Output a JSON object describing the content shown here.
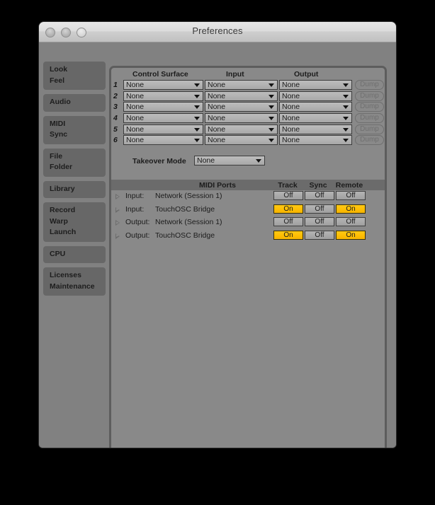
{
  "window": {
    "title": "Preferences",
    "traffic_lights": [
      "close-button",
      "minimize-button",
      "zoom-button"
    ]
  },
  "sidebar": {
    "groups": [
      {
        "lines": [
          "Look",
          "Feel"
        ]
      },
      {
        "lines": [
          "Audio"
        ]
      },
      {
        "lines": [
          "MIDI",
          "Sync"
        ]
      },
      {
        "lines": [
          "File",
          "Folder"
        ]
      },
      {
        "lines": [
          "Library"
        ]
      },
      {
        "lines": [
          "Record",
          "Warp",
          "Launch"
        ]
      },
      {
        "lines": [
          "CPU"
        ]
      },
      {
        "lines": [
          "Licenses",
          "Maintenance"
        ]
      }
    ]
  },
  "control_surface": {
    "headers": {
      "control_surface": "Control Surface",
      "input": "Input",
      "output": "Output"
    },
    "dump_label": "Dump",
    "rows": [
      {
        "num": "1",
        "surface": "None",
        "input": "None",
        "output": "None"
      },
      {
        "num": "2",
        "surface": "None",
        "input": "None",
        "output": "None"
      },
      {
        "num": "3",
        "surface": "None",
        "input": "None",
        "output": "None"
      },
      {
        "num": "4",
        "surface": "None",
        "input": "None",
        "output": "None"
      },
      {
        "num": "5",
        "surface": "None",
        "input": "None",
        "output": "None"
      },
      {
        "num": "6",
        "surface": "None",
        "input": "None",
        "output": "None"
      }
    ]
  },
  "takeover": {
    "label": "Takeover Mode",
    "value": "None"
  },
  "midi_ports": {
    "headers": {
      "ports": "MIDI Ports",
      "track": "Track",
      "sync": "Sync",
      "remote": "Remote"
    },
    "rows": [
      {
        "direction": "Input:",
        "name": "Network (Session 1)",
        "track": "Off",
        "sync": "Off",
        "remote": "Off"
      },
      {
        "direction": "Input:",
        "name": "TouchOSC Bridge",
        "track": "On",
        "sync": "Off",
        "remote": "On"
      },
      {
        "direction": "Output:",
        "name": "Network (Session 1)",
        "track": "Off",
        "sync": "Off",
        "remote": "Off"
      },
      {
        "direction": "Output:",
        "name": "TouchOSC Bridge",
        "track": "On",
        "sync": "Off",
        "remote": "On"
      }
    ]
  },
  "colors": {
    "toggle_on": "#ffbf05",
    "toggle_off": "#aaaaaa",
    "window_bg": "#818181",
    "panel_bg": "#898989",
    "sidebar_item": "#676767",
    "midi_header": "#6b6b6b"
  }
}
